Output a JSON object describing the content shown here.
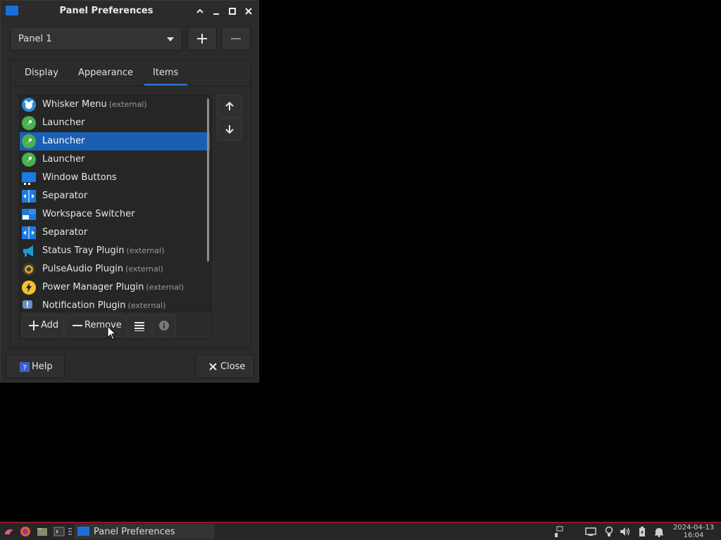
{
  "window": {
    "title": "Panel Preferences"
  },
  "panel_selector": {
    "selected": "Panel 1"
  },
  "tabs": [
    {
      "label": "Display"
    },
    {
      "label": "Appearance"
    },
    {
      "label": "Items",
      "active": true
    }
  ],
  "items": [
    {
      "name": "Whisker Menu",
      "suffix": "(external)",
      "icon": "whisker-menu-icon"
    },
    {
      "name": "Launcher",
      "suffix": "",
      "icon": "launcher-icon"
    },
    {
      "name": "Launcher",
      "suffix": "",
      "icon": "launcher-icon",
      "selected": true
    },
    {
      "name": "Launcher",
      "suffix": "",
      "icon": "launcher-icon"
    },
    {
      "name": "Window Buttons",
      "suffix": "",
      "icon": "window-buttons-icon"
    },
    {
      "name": "Separator",
      "suffix": "",
      "icon": "separator-icon"
    },
    {
      "name": "Workspace Switcher",
      "suffix": "",
      "icon": "workspace-switcher-icon"
    },
    {
      "name": "Separator",
      "suffix": "",
      "icon": "separator-icon"
    },
    {
      "name": "Status Tray Plugin",
      "suffix": "(external)",
      "icon": "status-tray-icon"
    },
    {
      "name": "PulseAudio Plugin",
      "suffix": "(external)",
      "icon": "pulseaudio-icon"
    },
    {
      "name": "Power Manager Plugin",
      "suffix": "(external)",
      "icon": "power-manager-icon"
    },
    {
      "name": "Notification Plugin",
      "suffix": "(external)",
      "icon": "notification-icon"
    }
  ],
  "list_toolbar": {
    "add_label": "Add",
    "remove_label": "Remove"
  },
  "buttons": {
    "help_label": "Help",
    "close_label": "Close"
  },
  "taskbar": {
    "task_label": "Panel Preferences",
    "clock_date": "2024-04-13",
    "clock_time": "16:04"
  },
  "colors": {
    "selection": "#1a5fb4",
    "accent": "#2a6ccb",
    "taskbar_border": "#8a1a2a"
  }
}
